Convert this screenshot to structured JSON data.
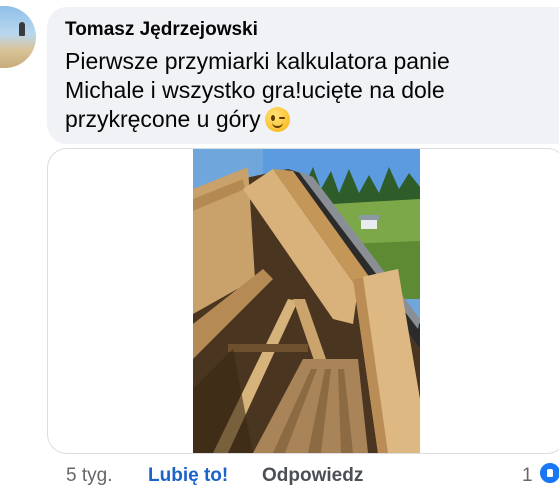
{
  "comment": {
    "author": "Tomasz Jędrzejowski",
    "message": "Pierwsze  przymiarki kalkulatora panie Michale i wszystko gra!ucięte na dole przykręcone u góry",
    "emoji": "winking-face-icon",
    "image": "roof-rafters-photo",
    "time": "5 tyg.",
    "like_label": "Lubię to!",
    "reply_label": "Odpowiedz",
    "reaction_count": "1",
    "reaction_icon": "like-thumb-icon"
  },
  "colors": {
    "bubble_bg": "#f0f2f5",
    "like_link": "#1b63c9",
    "meta_text": "#65676b",
    "reaction_bg": "#1877f2"
  }
}
